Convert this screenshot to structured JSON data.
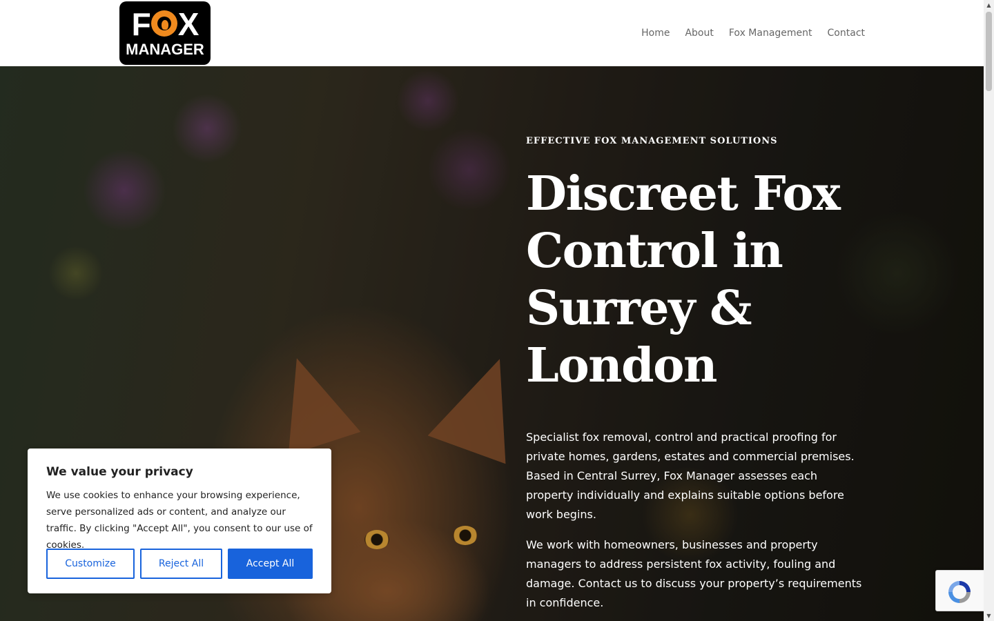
{
  "brand": {
    "logo_top": "FOX",
    "logo_bottom": "MANAGER"
  },
  "nav": {
    "items": [
      {
        "label": "Home"
      },
      {
        "label": "About"
      },
      {
        "label": "Fox Management"
      },
      {
        "label": "Contact"
      }
    ]
  },
  "hero": {
    "eyebrow": "EFFECTIVE FOX MANAGEMENT SOLUTIONS",
    "headline": "Discreet Fox Control in Surrey & London",
    "paragraph_1": "Specialist fox removal, control and practical proofing for private homes, gardens, estates and commercial premises. Based in Central Surrey, Fox Manager assesses each property individually and explains suitable options before work begins.",
    "paragraph_2": "We work with homeowners, businesses and property managers to address persistent fox activity, fouling and damage. Contact us to discuss your property’s requirements in confidence."
  },
  "cookie_banner": {
    "title": "We value your privacy",
    "text": "We use cookies to enhance your browsing experience, serve personalized ads or content, and analyze our traffic. By clicking \"Accept All\", you consent to our use of cookies.",
    "customize_label": "Customize",
    "reject_label": "Reject All",
    "accept_label": "Accept All",
    "accent_color": "#1863dc"
  },
  "colors": {
    "nav_text": "#666666",
    "logo_accent": "#f08a1e"
  },
  "icons": {
    "recaptcha": "recaptcha-icon",
    "scroll_up": "scroll-up-arrow-icon",
    "scroll_down": "scroll-down-arrow-icon"
  }
}
